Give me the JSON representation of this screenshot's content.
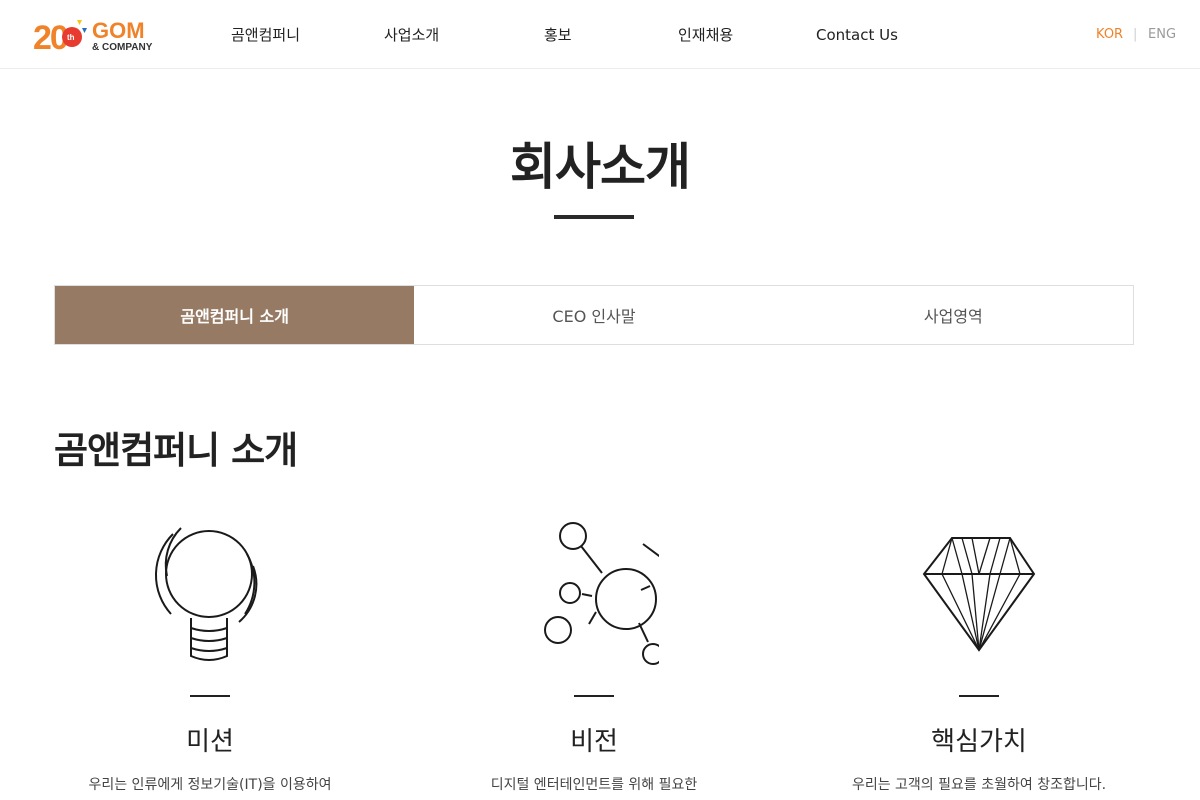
{
  "header": {
    "logo": {
      "mark_text": "20",
      "mark_superscript": "th",
      "brand": "GOM",
      "sub_brand": "& COMPANY",
      "colors": {
        "orange": "#f0822a",
        "red": "#e63b2e",
        "blue": "#2a6ebb"
      }
    },
    "nav": [
      {
        "label": "곰앤컴퍼니"
      },
      {
        "label": "사업소개"
      },
      {
        "label": "홍보"
      },
      {
        "label": "인재채용"
      },
      {
        "label": "Contact Us"
      }
    ],
    "lang": {
      "kor": "KOR",
      "separator": "|",
      "eng": "ENG",
      "active_color": "#f0822a"
    }
  },
  "page": {
    "title": "회사소개"
  },
  "tabs": [
    {
      "label": "곰앤컴퍼니 소개",
      "active": true
    },
    {
      "label": "CEO 인사말",
      "active": false
    },
    {
      "label": "사업영역",
      "active": false
    }
  ],
  "accent_color": "#977a63",
  "section": {
    "title": "곰앤컴퍼니 소개",
    "columns": [
      {
        "icon": "lightbulb-icon",
        "title": "미션",
        "desc": "우리는 인류에게 정보기술(IT)을 이용하여"
      },
      {
        "icon": "network-molecule-icon",
        "title": "비전",
        "desc": "디지털 엔터테인먼트를 위해 필요한"
      },
      {
        "icon": "diamond-icon",
        "title": "핵심가치",
        "desc": "우리는 고객의 필요를 초월하여 창조합니다."
      }
    ]
  }
}
